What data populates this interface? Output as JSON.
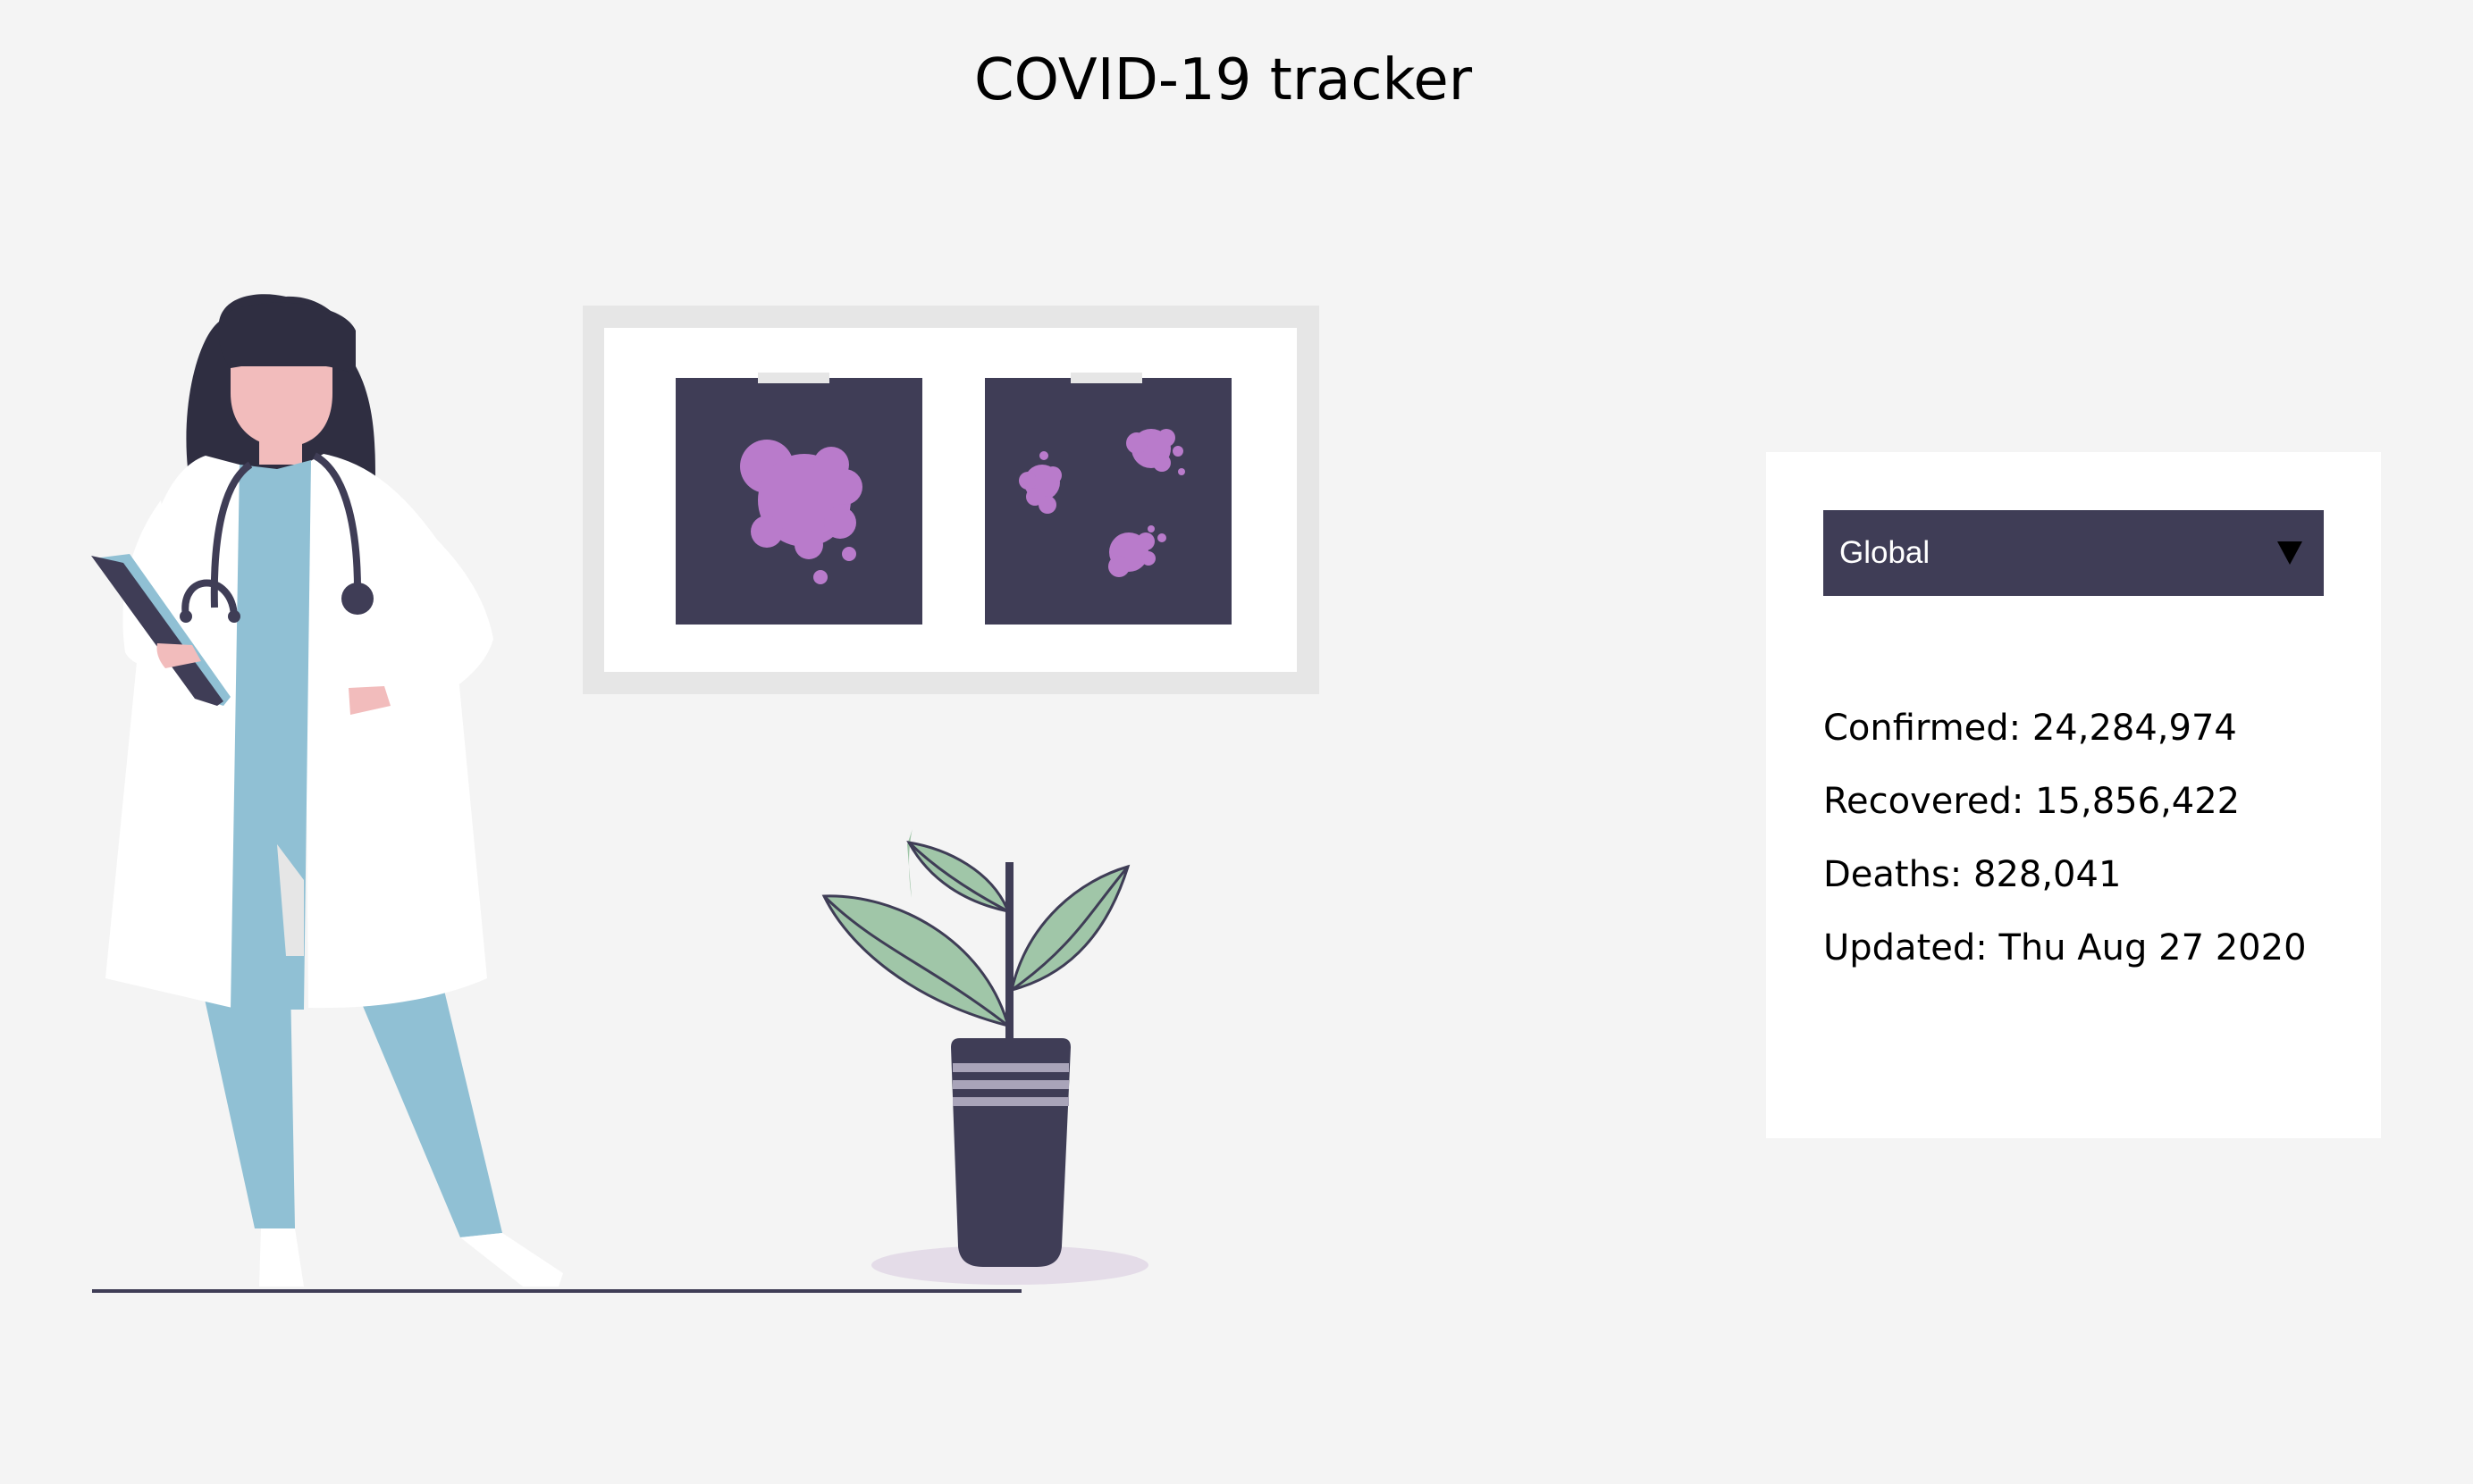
{
  "page": {
    "title": "COVID-19 tracker"
  },
  "region_select": {
    "selected": "Global"
  },
  "stats": {
    "confirmed": "Confirmed: 24,284,974",
    "recovered": "Recovered: 15,856,422",
    "deaths": "Deaths: 828,041",
    "updated": "Updated: Thu Aug 27 2020"
  },
  "icons": {
    "select_arrow": "triangle-down-icon"
  },
  "colors": {
    "background": "#f4f4f4",
    "card": "#ffffff",
    "dark": "#3f3d56",
    "virus": "#b97bcb",
    "scrubs": "#90c0d4",
    "skin": "#f2bcbc",
    "leaf": "#a0c6a8"
  }
}
